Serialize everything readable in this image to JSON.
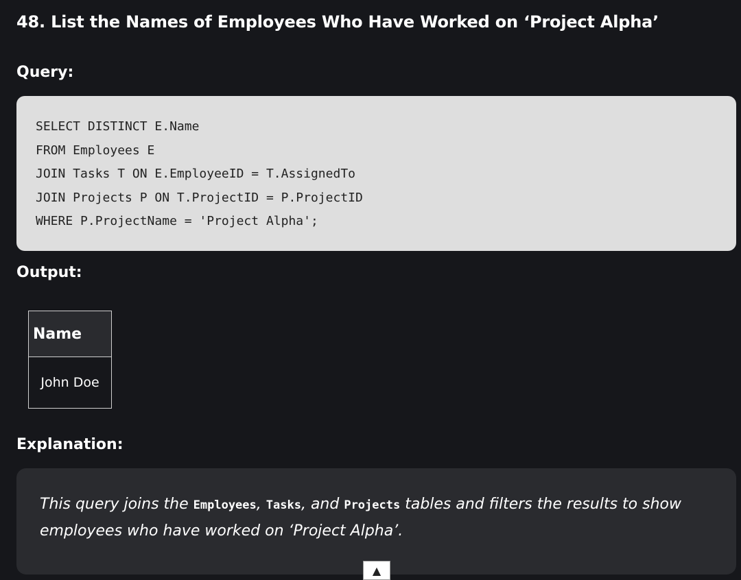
{
  "title": "48. List the Names of Employees Who Have Worked on ‘Project Alpha’",
  "query_heading": "Query:",
  "code_lines": [
    "SELECT DISTINCT E.Name",
    "FROM Employees E",
    "JOIN Tasks T ON E.EmployeeID = T.AssignedTo",
    "JOIN Projects P ON T.ProjectID = P.ProjectID",
    "WHERE P.ProjectName = 'Project Alpha';"
  ],
  "output_heading": "Output:",
  "output_table": {
    "header": "Name",
    "rows": [
      "John Doe"
    ]
  },
  "explanation_heading": "Explanation:",
  "explanation": {
    "part1": "This query joins the ",
    "code1": "Employees",
    "part2": ", ",
    "code2": "Tasks",
    "part3": ", and ",
    "code3": "Projects",
    "part4": " tables and filters the results to show employees who have worked on ‘Project Alpha’."
  },
  "scroll_top_icon": "▲",
  "colors": {
    "background": "#16171b",
    "code_bg": "#dedede",
    "explain_bg": "#2a2b2f"
  }
}
